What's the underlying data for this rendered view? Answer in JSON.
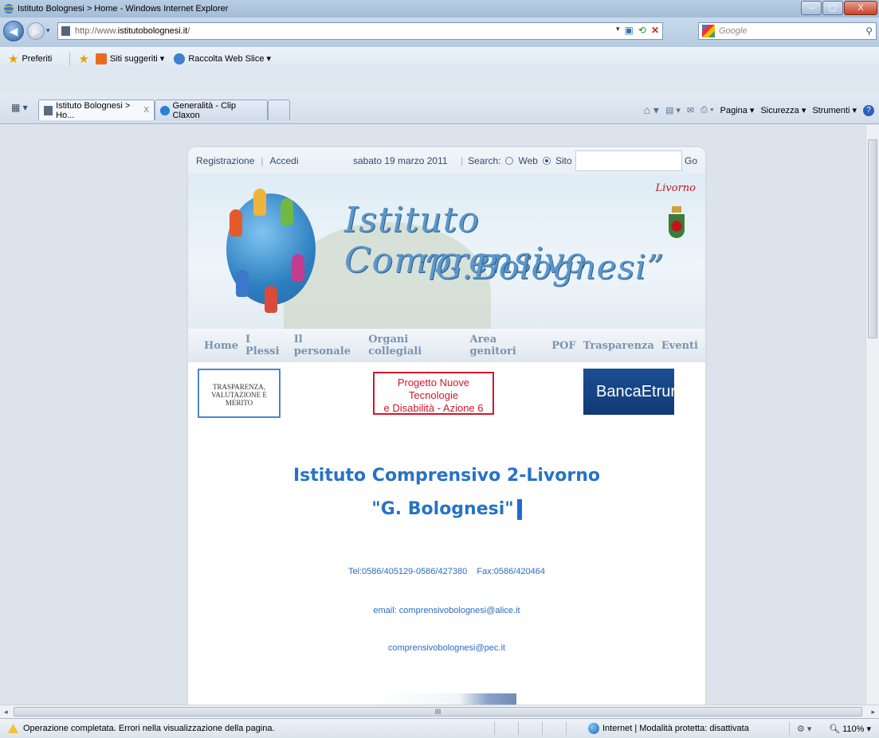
{
  "window": {
    "title": "Istituto Bolognesi > Home - Windows Internet Explorer",
    "min": "–",
    "max": "▢",
    "close": "X"
  },
  "address": {
    "url_prefix": "http://www.",
    "url_domain": "istitutobolognesi.it",
    "url_suffix": "/",
    "search_placeholder": "Google"
  },
  "favorites": {
    "items": [
      {
        "label": "Preferiti"
      },
      {
        "label": "Siti suggeriti ▾"
      },
      {
        "label": "Raccolta Web Slice ▾"
      }
    ]
  },
  "tabs": [
    {
      "label": "Istituto Bolognesi > Ho...",
      "close": "X"
    },
    {
      "label": "Generalità - Clip Claxon"
    }
  ],
  "commandbar": {
    "pagina": "Pagina ▾",
    "sicurezza": "Sicurezza ▾",
    "strumenti": "Strumenti ▾"
  },
  "site": {
    "register": "Registrazione",
    "login": "Accedi",
    "date": "sabato 19 marzo 2011",
    "search_label": "Search:",
    "opt_web": "Web",
    "opt_site": "Sito",
    "go": "Go",
    "banner_title_1": "Istituto Comprensivo",
    "banner_title_2": "“G.Bolognesi”",
    "city": "Livorno",
    "menu": [
      "Home",
      "I Plessi",
      "Il personale",
      "Organi collegiali",
      "Area genitori",
      "POF",
      "Trasparenza",
      "Eventi"
    ],
    "logo1": "TRASPARENZA, VALUTAZIONE E MERITO",
    "logo2_line1": "Progetto Nuove Tecnologie",
    "logo2_line2": "e Disabilità - Azione 6",
    "logo3": "BancaEtruria",
    "heading1": "Istituto Comprensivo 2-Livorno",
    "heading2": "\"G. Bolognesi\"",
    "phone": "Tel:0586/405129-0586/427380    Fax:0586/420464",
    "email": "email: comprensivobolognesi@alice.it",
    "pec": "comprensivobolognesi@pec.it"
  },
  "status": {
    "message": "Operazione completata. Errori nella visualizzazione della pagina.",
    "zone": "Internet | Modalità protetta: disattivata",
    "zoom": "110%"
  },
  "colors": {
    "accent": "#2673c6",
    "menu_text": "#7894b2",
    "city_red": "#c0151c"
  }
}
